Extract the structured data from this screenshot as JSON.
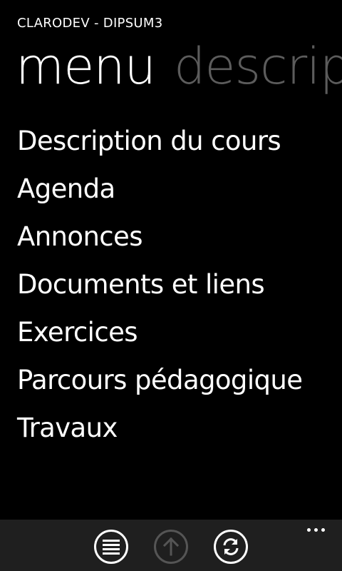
{
  "app": {
    "title": "CLARODEV - DIPSUM3"
  },
  "pivot": {
    "tabs": [
      {
        "label": "menu",
        "active": true
      },
      {
        "label": "description",
        "active": false
      }
    ]
  },
  "menu": {
    "items": [
      {
        "label": "Description du cours"
      },
      {
        "label": "Agenda"
      },
      {
        "label": "Annonces"
      },
      {
        "label": "Documents et liens"
      },
      {
        "label": "Exercices"
      },
      {
        "label": "Parcours pédagogique"
      },
      {
        "label": "Travaux"
      }
    ]
  },
  "app_bar": {
    "buttons": [
      {
        "icon": "list-icon",
        "enabled": true
      },
      {
        "icon": "arrow-up-icon",
        "enabled": false
      },
      {
        "icon": "refresh-icon",
        "enabled": true
      }
    ],
    "more_icon": "more-dots-icon"
  },
  "colors": {
    "background": "#000000",
    "foreground": "#ffffff",
    "inactive_tab": "#5c5c5c",
    "app_bar": "#1f1f1f"
  }
}
